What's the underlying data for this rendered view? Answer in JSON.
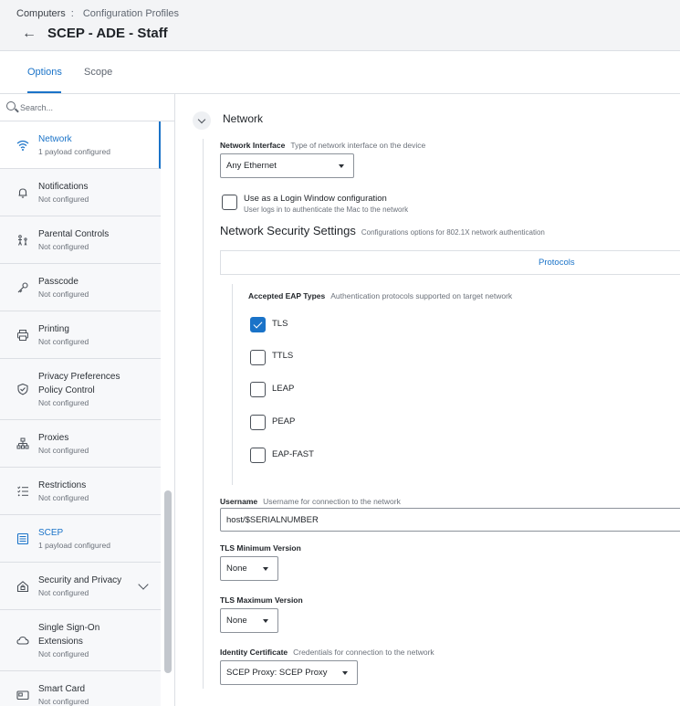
{
  "breadcrumb": {
    "root": "Computers",
    "separator": ":",
    "current": "Configuration Profiles"
  },
  "page": {
    "back_icon": "arrow-left-icon",
    "title": "SCEP - ADE - Staff"
  },
  "tabs": [
    {
      "label": "Options",
      "active": true
    },
    {
      "label": "Scope",
      "active": false
    }
  ],
  "sidebar": {
    "search_placeholder": "Search...",
    "items": [
      {
        "label": "Network",
        "status": "1 payload configured",
        "icon": "wifi-icon",
        "active": true
      },
      {
        "label": "Notifications",
        "status": "Not configured",
        "icon": "bell-icon"
      },
      {
        "label": "Parental Controls",
        "status": "Not configured",
        "icon": "family-icon"
      },
      {
        "label": "Passcode",
        "status": "Not configured",
        "icon": "key-icon"
      },
      {
        "label": "Printing",
        "status": "Not configured",
        "icon": "printer-icon"
      },
      {
        "label": "Privacy Preferences Policy Control",
        "label_line1": "Privacy Preferences",
        "label_line2": "Policy Control",
        "status": "Not configured",
        "icon": "shield-icon"
      },
      {
        "label": "Proxies",
        "status": "Not configured",
        "icon": "network-tree-icon"
      },
      {
        "label": "Restrictions",
        "status": "Not configured",
        "icon": "checklist-icon"
      },
      {
        "label": "SCEP",
        "status": "1 payload configured",
        "icon": "document-icon",
        "highlight": true
      },
      {
        "label": "Security and Privacy",
        "status": "Not configured",
        "icon": "house-lock-icon",
        "expandable": true
      },
      {
        "label": "Single Sign-On Extensions",
        "label_line1": "Single Sign-On",
        "label_line2": "Extensions",
        "status": "Not configured",
        "icon": "cloud-icon"
      },
      {
        "label": "Smart Card",
        "status": "Not configured",
        "icon": "smart-card-icon"
      }
    ]
  },
  "main": {
    "section_title": "Network",
    "network_interface": {
      "label": "Network Interface",
      "description": "Type of network interface on the device",
      "value": "Any Ethernet"
    },
    "login_window": {
      "label": "Use as a Login Window configuration",
      "sub": "User logs in to authenticate the Mac to the network",
      "checked": false
    },
    "security_settings": {
      "title": "Network Security Settings",
      "description": "Configurations options for 802.1X network authentication"
    },
    "protocols_tab": "Protocols",
    "eap": {
      "label": "Accepted EAP Types",
      "description": "Authentication protocols supported on target network",
      "options": [
        {
          "label": "TLS",
          "checked": true
        },
        {
          "label": "TTLS",
          "checked": false
        },
        {
          "label": "LEAP",
          "checked": false
        },
        {
          "label": "PEAP",
          "checked": false
        },
        {
          "label": "EAP-FAST",
          "checked": false
        }
      ]
    },
    "username": {
      "label": "Username",
      "description": "Username for connection to the network",
      "value": "host/$SERIALNUMBER"
    },
    "tls_min": {
      "label": "TLS Minimum Version",
      "value": "None"
    },
    "tls_max": {
      "label": "TLS Maximum Version",
      "value": "None"
    },
    "identity_cert": {
      "label": "Identity Certificate",
      "description": "Credentials for connection to the network",
      "value": "SCEP Proxy: SCEP Proxy"
    }
  },
  "colors": {
    "accent": "#1a73c8",
    "header_bg": "#f3f4f6",
    "border": "#dcdfe4"
  }
}
